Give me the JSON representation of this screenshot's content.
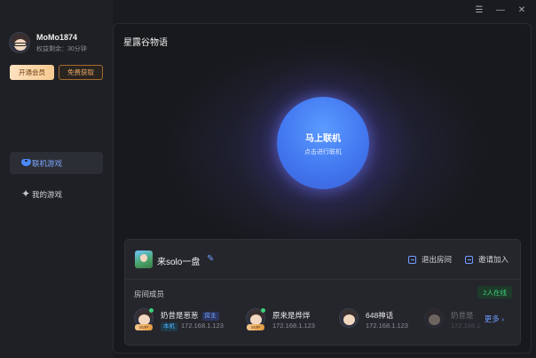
{
  "window": {
    "menu_icon": "menu-icon",
    "minimize_icon": "minimize-icon",
    "close_icon": "close-icon"
  },
  "user": {
    "name": "MoMo1874",
    "remaining": "权益剩余：30分钟"
  },
  "sidebar": {
    "vip_label": "开通会员",
    "free_label": "免费获取",
    "items": [
      {
        "label": "联机游戏",
        "icon": "gamepad-icon",
        "active": true
      },
      {
        "label": "我的游戏",
        "icon": "sparkle-icon",
        "active": false
      }
    ]
  },
  "main": {
    "title": "星露谷物语",
    "connect": {
      "label": "马上联机",
      "sub": "点击进行联机"
    }
  },
  "room": {
    "name": "来solo一盘",
    "leave_label": "退出房间",
    "invite_label": "邀请加入",
    "members_label": "房间成员",
    "online_count": "2人在线",
    "more_label": "更多",
    "members": [
      {
        "name": "奶昔是葱葱",
        "tag": "房主",
        "local_tag": "本机",
        "ip": "172.168.1.123",
        "online": true,
        "svip": "SVIP"
      },
      {
        "name": "原来是烨烨",
        "ip": "172.168.1.123",
        "online": true,
        "svip": "SVIP"
      },
      {
        "name": "648神话",
        "ip": "172.168.1.123",
        "online": false
      },
      {
        "name": "奶昔是",
        "ip": "172.168.1",
        "online": false
      }
    ]
  },
  "colors": {
    "accent": "#4a8aff",
    "online": "#3bd07a",
    "vip": "#f6c98f"
  }
}
